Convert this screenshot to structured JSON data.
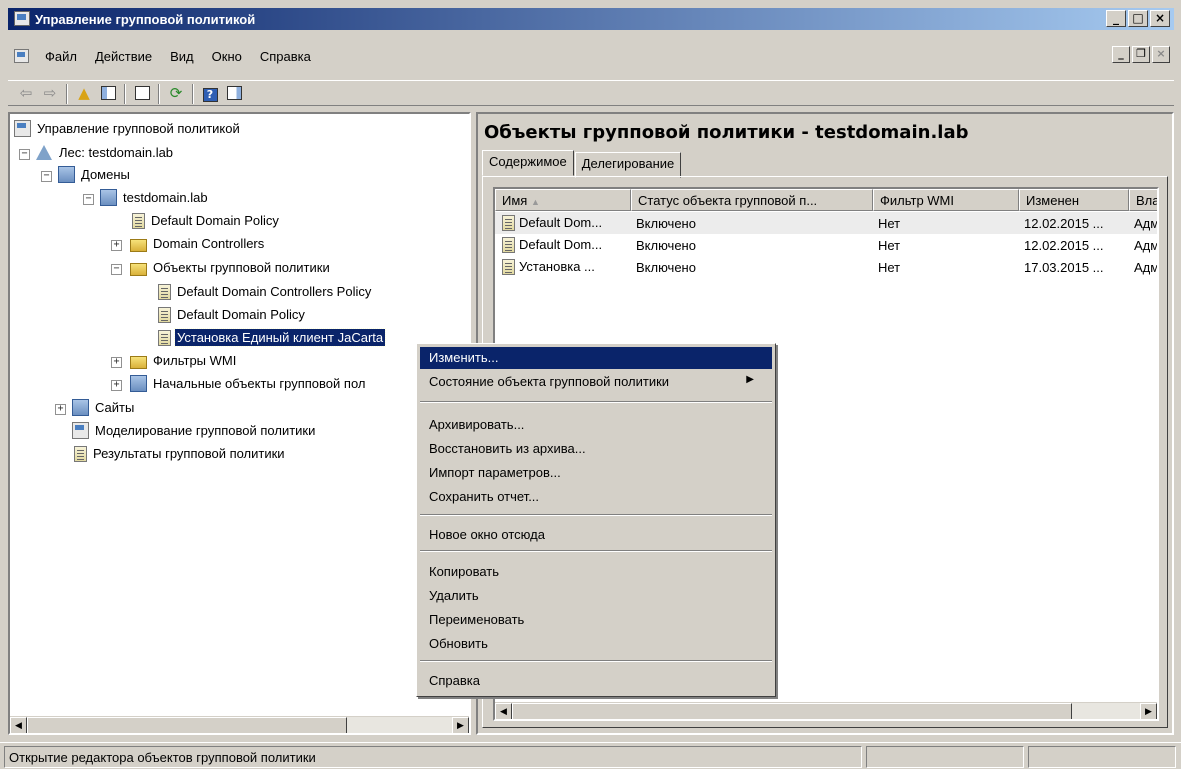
{
  "window": {
    "title": "Управление групповой политикой"
  },
  "menu": [
    "Файл",
    "Действие",
    "Вид",
    "Окно",
    "Справка"
  ],
  "tree": {
    "root": "Управление групповой политикой",
    "forest": "Лес: testdomain.lab",
    "domains": "Домены",
    "domain": "testdomain.lab",
    "default_domain_policy_link": "Default Domain Policy",
    "domain_controllers": "Domain Controllers",
    "gpo_folder": "Объекты групповой политики",
    "gpo_dc_policy": "Default Domain Controllers Policy",
    "gpo_domain_policy": "Default Domain Policy",
    "gpo_jacarta": "Установка Единый клиент JaCarta",
    "wmi_filters": "Фильтры WMI",
    "starter_gpos": "Начальные объекты групповой пол",
    "sites": "Сайты",
    "modeling": "Моделирование групповой политики",
    "results": "Результаты групповой политики"
  },
  "right_pane": {
    "title": "Объекты групповой политики - testdomain.lab",
    "tabs": [
      "Содержимое",
      "Делегирование"
    ],
    "columns": [
      "Имя",
      "Статус объекта групповой п...",
      "Фильтр WMI",
      "Изменен",
      "Вла"
    ],
    "rows": [
      [
        "Default Dom...",
        "Включено",
        "Нет",
        "12.02.2015 ...",
        "Адм"
      ],
      [
        "Default Dom...",
        "Включено",
        "Нет",
        "12.02.2015 ...",
        "Адм"
      ],
      [
        "Установка ...",
        "Включено",
        "Нет",
        "17.03.2015 ...",
        "Адм"
      ]
    ]
  },
  "context_menu": {
    "edit": "Изменить...",
    "gpo_status": "Состояние объекта групповой политики",
    "backup": "Архивировать...",
    "restore": "Восстановить из архива...",
    "import": "Импорт параметров...",
    "save_report": "Сохранить отчет...",
    "new_window": "Новое окно отсюда",
    "copy": "Копировать",
    "delete": "Удалить",
    "rename": "Переименовать",
    "refresh": "Обновить",
    "help": "Справка"
  },
  "status": {
    "text": "Открытие редактора объектов групповой политики"
  }
}
